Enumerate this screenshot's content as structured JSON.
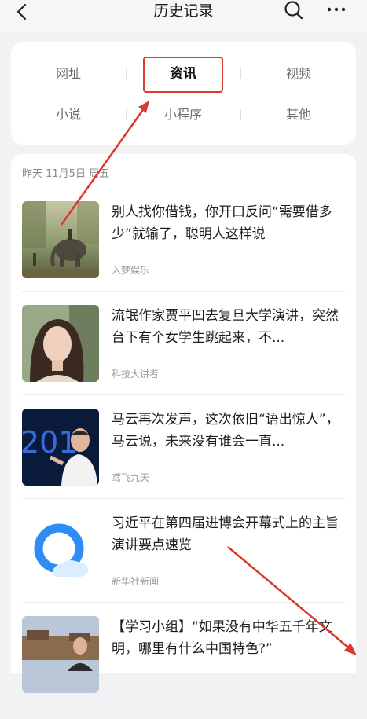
{
  "header": {
    "title": "历史记录",
    "back_icon": "chevron-left-icon",
    "search_icon": "search-icon",
    "more_icon": "more-dots-icon"
  },
  "filters": [
    {
      "label": "网址",
      "active": false
    },
    {
      "label": "资讯",
      "active": true
    },
    {
      "label": "视频",
      "active": false
    },
    {
      "label": "小说",
      "active": false
    },
    {
      "label": "小程序",
      "active": false
    },
    {
      "label": "其他",
      "active": false
    }
  ],
  "history": {
    "date_label": "昨天 11月5日 周五",
    "items": [
      {
        "title": "别人找你借钱，你开口反问“需要借多少”就输了，聪明人这样说",
        "source": "入梦娱乐"
      },
      {
        "title": "流氓作家贾平凹去复旦大学演讲，突然台下有个女学生跳起来，不...",
        "source": "科技大讲者"
      },
      {
        "title": "马云再次发声，这次依旧“语出惊人”，马云说，未来没有谁会一直...",
        "source": "鸢飞九天"
      },
      {
        "title": "习近平在第四届进博会开幕式上的主旨演讲要点速览",
        "source": "新华社新闻"
      },
      {
        "title": "【学习小组】“如果没有中华五千年文明，哪里有什么中国特色?”",
        "source": ""
      }
    ]
  },
  "colors": {
    "annotation_red": "#d93a2f",
    "background": "#f2f2f4",
    "card": "#ffffff"
  }
}
